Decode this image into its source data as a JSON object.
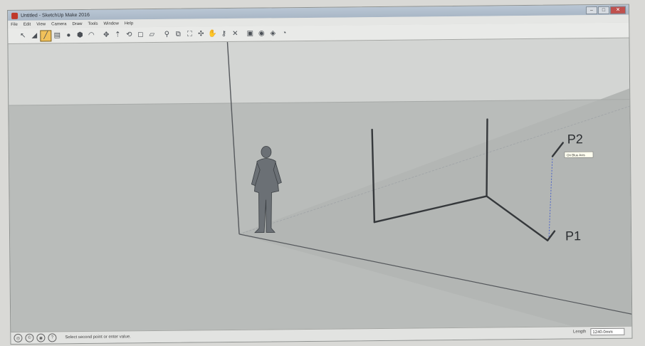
{
  "window": {
    "title": "Untitled - SketchUp Make 2016"
  },
  "menubar": {
    "items": [
      "File",
      "Edit",
      "View",
      "Camera",
      "Draw",
      "Tools",
      "Window",
      "Help"
    ]
  },
  "toolbar": {
    "tools": [
      {
        "name": "select-tool-icon",
        "glyph": "↖"
      },
      {
        "name": "eraser-tool-icon",
        "glyph": "◢"
      },
      {
        "name": "line-tool-icon",
        "glyph": "╱",
        "active": true
      },
      {
        "name": "rectangle-tool-icon",
        "glyph": "▤"
      },
      {
        "name": "circle-tool-icon",
        "glyph": "●"
      },
      {
        "name": "polygon-tool-icon",
        "glyph": "⬢"
      },
      {
        "name": "arc-tool-icon",
        "glyph": "◠"
      },
      {
        "name": "move-tool-icon",
        "glyph": "✥"
      },
      {
        "name": "push-pull-tool-icon",
        "glyph": "⇡"
      },
      {
        "name": "rotate-tool-icon",
        "glyph": "⟲"
      },
      {
        "name": "offset-tool-icon",
        "glyph": "◻"
      },
      {
        "name": "tape-measure-tool-icon",
        "glyph": "▱"
      },
      {
        "name": "zoom-tool-icon",
        "glyph": "⚲"
      },
      {
        "name": "zoom-window-tool-icon",
        "glyph": "⧉"
      },
      {
        "name": "zoom-extents-tool-icon",
        "glyph": "⛶"
      },
      {
        "name": "orbit-tool-icon",
        "glyph": "✣"
      },
      {
        "name": "pan-tool-icon",
        "glyph": "✋"
      },
      {
        "name": "walk-tool-icon",
        "glyph": "⚷"
      },
      {
        "name": "section-plane-tool-icon",
        "glyph": "✕"
      },
      {
        "name": "components-icon",
        "glyph": "▣"
      },
      {
        "name": "warehouse-icon",
        "glyph": "◉"
      },
      {
        "name": "extension-warehouse-icon",
        "glyph": "◈"
      },
      {
        "name": "layout-icon",
        "glyph": "◔"
      }
    ]
  },
  "scene": {
    "point_labels": {
      "p2": "P2",
      "p1": "P1"
    },
    "tooltip": "On Blue Axis"
  },
  "statusbar": {
    "hint": "Select second point or enter value.",
    "measurement_label": "Length",
    "measurement_value": "1240.0mm"
  },
  "colors": {
    "sky": "#d3d5d3",
    "ground": "#b9bcba",
    "axis_blue": "#4a62c8",
    "edge": "#3a3d40"
  }
}
